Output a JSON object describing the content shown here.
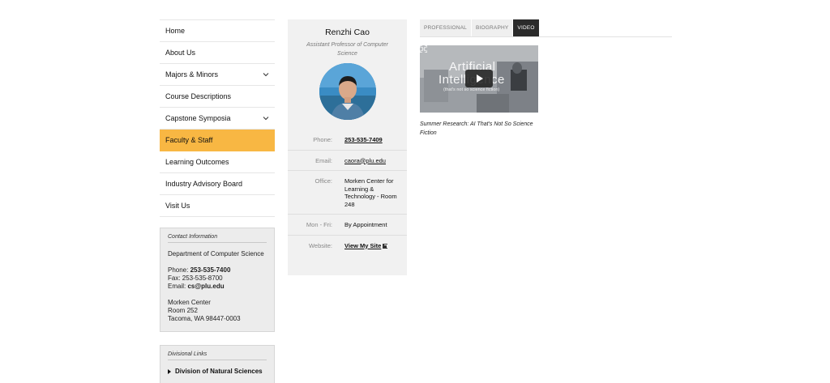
{
  "nav": {
    "items": [
      {
        "label": "Home"
      },
      {
        "label": "About Us"
      },
      {
        "label": "Majors & Minors"
      },
      {
        "label": "Course Descriptions"
      },
      {
        "label": "Capstone Symposia"
      },
      {
        "label": "Faculty & Staff"
      },
      {
        "label": "Learning Outcomes"
      },
      {
        "label": "Industry Advisory Board"
      },
      {
        "label": "Visit Us"
      }
    ],
    "active_color": "#f8b743"
  },
  "contact": {
    "title": "Contact Information",
    "department": "Department of Computer Science",
    "phone_label": "Phone: ",
    "phone": "253-535-7400",
    "fax": "Fax: 253-535-8700",
    "email_label": "Email: ",
    "email": "cs@plu.edu",
    "address1": "Morken Center",
    "address2": "Room 252",
    "address3": "Tacoma, WA 98447-0003"
  },
  "divisional": {
    "title": "Divisional Links",
    "link": "Division of Natural Sciences"
  },
  "profile": {
    "name": "Renzhi Cao",
    "title": "Assistant Professor of Computer Science",
    "rows": [
      {
        "label": "Phone:",
        "value": "253-535-7409"
      },
      {
        "label": "Email:",
        "value": "caora@plu.edu"
      },
      {
        "label": "Office:",
        "value": "Morken Center for Learning & Technology - Room 248"
      },
      {
        "label": "Mon - Fri:",
        "value": "By Appointment"
      },
      {
        "label": "Website:",
        "value": "View My Site"
      }
    ]
  },
  "tabs": [
    {
      "label": "PROFESSIONAL"
    },
    {
      "label": "BIOGRAPHY"
    },
    {
      "label": "VIDEO"
    }
  ],
  "video": {
    "overlay_line1": "Artificial",
    "overlay_line2": "Intelligence",
    "overlay_sub": "(that's not so science fiction)",
    "caption": "Summer Research: AI That's Not So Science Fiction"
  }
}
